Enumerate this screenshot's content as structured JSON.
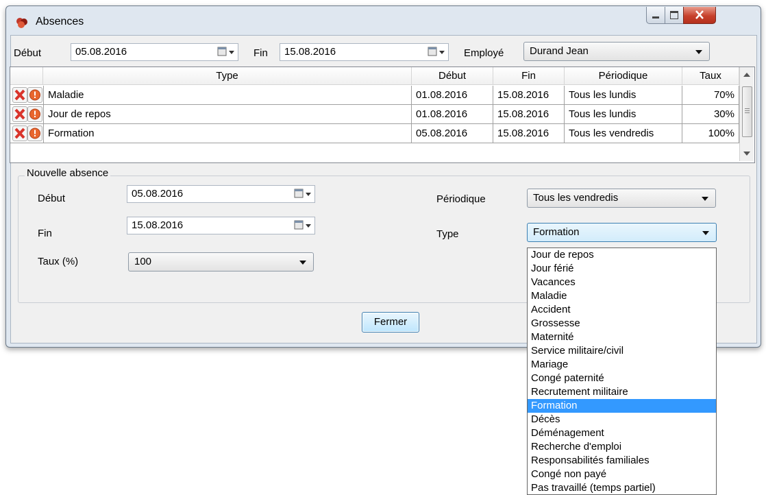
{
  "window": {
    "title": "Absences"
  },
  "filter": {
    "debut_label": "Début",
    "debut_value": "05.08.2016",
    "fin_label": "Fin",
    "fin_value": "15.08.2016",
    "employe_label": "Employé",
    "employe_value": "Durand Jean"
  },
  "grid": {
    "headers": [
      "Type",
      "Début",
      "Fin",
      "Périodique",
      "Taux"
    ],
    "rows": [
      {
        "type": "Maladie",
        "debut": "01.08.2016",
        "fin": "15.08.2016",
        "periodique": "Tous les lundis",
        "taux": "70%"
      },
      {
        "type": "Jour de repos",
        "debut": "01.08.2016",
        "fin": "15.08.2016",
        "periodique": "Tous les lundis",
        "taux": "30%"
      },
      {
        "type": "Formation",
        "debut": "05.08.2016",
        "fin": "15.08.2016",
        "periodique": "Tous les vendredis",
        "taux": "100%"
      }
    ]
  },
  "nouvelle": {
    "legend": "Nouvelle absence",
    "debut_label": "Début",
    "debut_value": "05.08.2016",
    "fin_label": "Fin",
    "fin_value": "15.08.2016",
    "taux_label": "Taux (%)",
    "taux_value": "100",
    "periodique_label": "Périodique",
    "periodique_value": "Tous les vendredis",
    "type_label": "Type",
    "type_value": "Formation"
  },
  "buttons": {
    "fermer": "Fermer"
  },
  "type_options": [
    "Jour de repos",
    "Jour férié",
    "Vacances",
    "Maladie",
    "Accident",
    "Grossesse",
    "Maternité",
    "Service militaire/civil",
    "Mariage",
    "Congé paternité",
    "Recrutement militaire",
    "Formation",
    "Décès",
    "Déménagement",
    "Recherche d'emploi",
    "Responsabilités familiales",
    "Congé non payé",
    "Pas travaillé (temps partiel)"
  ],
  "selected_option_index": 11,
  "colors": {
    "selection": "#3399ff",
    "close_button": "#c7412c"
  }
}
